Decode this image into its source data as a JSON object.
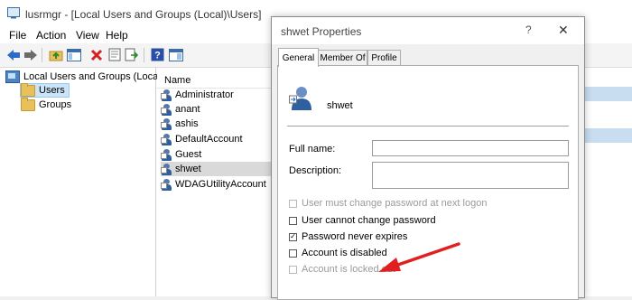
{
  "window": {
    "title": "lusrmgr - [Local Users and Groups (Local)\\Users]"
  },
  "menu": [
    "File",
    "Action",
    "View",
    "Help"
  ],
  "tree": {
    "root": "Local Users and Groups (Local)",
    "items": [
      "Users",
      "Groups"
    ]
  },
  "list": {
    "column": "Name",
    "users": [
      "Administrator",
      "anant",
      "ashis",
      "DefaultAccount",
      "Guest",
      "shwet",
      "WDAGUtilityAccount"
    ]
  },
  "dialog": {
    "title": "shwet Properties",
    "help": "?",
    "close": "✕",
    "tabs": [
      "General",
      "Member Of",
      "Profile"
    ],
    "username": "shwet",
    "full_name_label": "Full name:",
    "full_name_value": "",
    "description_label": "Description:",
    "description_value": "",
    "options": [
      {
        "label": "User must change password at next logon",
        "checked": false,
        "disabled": true
      },
      {
        "label": "User cannot change password",
        "checked": false,
        "disabled": false
      },
      {
        "label": "Password never expires",
        "checked": true,
        "disabled": false
      },
      {
        "label": "Account is disabled",
        "checked": false,
        "disabled": false
      },
      {
        "label": "Account is locked out",
        "checked": false,
        "disabled": true
      }
    ]
  },
  "colors": {
    "annotation_arrow": "#e02020",
    "selection": "#cce4f7"
  }
}
